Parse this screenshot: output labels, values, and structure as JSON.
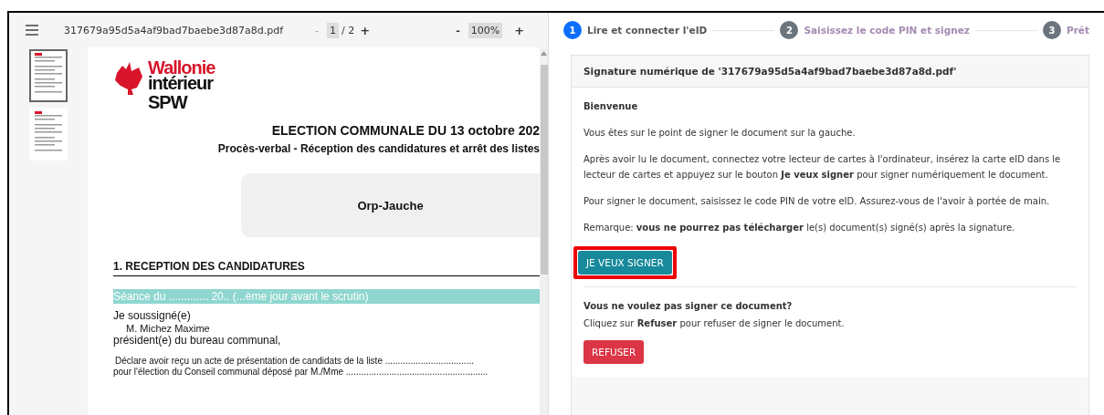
{
  "viewer": {
    "filename": "317679a95d5a4af9bad7baebe3d87a8d.pdf",
    "page_minus": "-",
    "page": "1",
    "page_total": "/ 2",
    "page_plus": "+",
    "zoom_minus": "-",
    "zoom": "100%",
    "zoom_plus": "+",
    "thumbnails": [
      {
        "selected": true
      },
      {
        "selected": false
      }
    ]
  },
  "document": {
    "logo": [
      "Wallonie",
      "intérieur",
      "SPW"
    ],
    "title": "ELECTION COMMUNALE DU 13 octobre 202",
    "subtitle": "Procès-verbal - Réception des candidatures et arrêt des listes",
    "commune": "Orp-Jauche",
    "section": "1. RECEPTION DES CANDIDATURES",
    "session": "Séance du ............. 20.. (...ème jour avant le scrutin)",
    "signer_label": "Je soussigné(e)",
    "signer_name": "M. Michez Maxime",
    "signer_role": "président(e) du bureau communal,",
    "lines": [
      "Déclare avoir reçu un acte de présentation de candidats de la liste ...................................",
      "pour l'élection du Conseil communal déposé par M./Mme ........................................................"
    ]
  },
  "steps": [
    {
      "number": "1",
      "label": "Lire et connecter l'eID",
      "selected": true
    },
    {
      "number": "2",
      "label": "Saisissez le code PIN et signez",
      "selected": false
    },
    {
      "number": "3",
      "label": "Prêt",
      "selected": false
    }
  ],
  "card": {
    "title": "Signature numérique de '317679a95d5a4af9bad7baebe3d87a8d.pdf'",
    "greeting": "Bienvenue",
    "paragraphs": [
      "Vous êtes sur le point de signer le document sur la gauche.",
      "Après avoir lu le document, connectez votre lecteur de cartes à l'ordinateur, insérez la carte eID dans le lecteur de cartes et appuyez sur le bouton **Je veux signer** pour signer numériquement le document.",
      "Pour signer le document, saisissez le code PIN de votre eID. Assurez-vous de l'avoir à portée de main.",
      "Remarque: **vous ne pourrez pas télécharger** le(s) document(s) signé(s) après la signature."
    ],
    "sign_button": "JE VEUX SIGNER",
    "decline_title": "Vous ne voulez pas signer ce document?",
    "decline_text": "Cliquez sur **Refuser** pour refuser de signer le document.",
    "refuse_button": "REFUSER"
  }
}
